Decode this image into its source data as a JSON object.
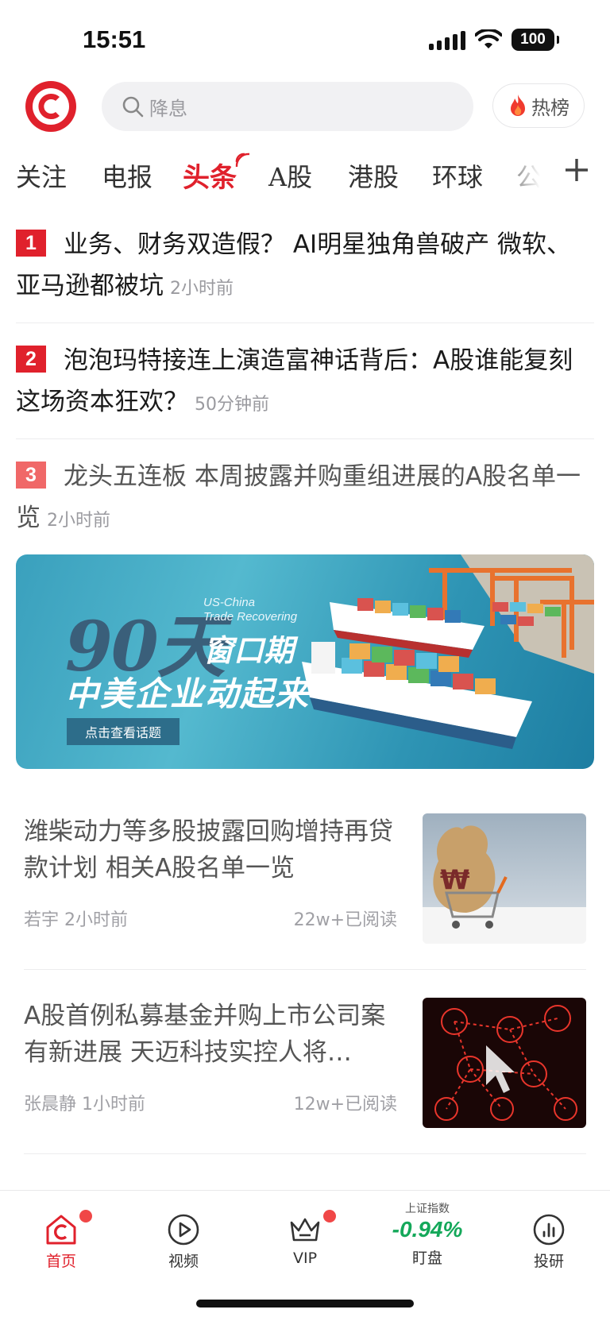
{
  "status": {
    "time": "15:51",
    "battery": "100"
  },
  "header": {
    "search_placeholder": "降息",
    "hot_label": "热榜",
    "logo_letter": "C"
  },
  "tabs": [
    {
      "label": "关注"
    },
    {
      "label": "电报"
    },
    {
      "label": "头条",
      "active": true
    },
    {
      "label": "A股"
    },
    {
      "label": "港股"
    },
    {
      "label": "环球"
    },
    {
      "label": "公"
    }
  ],
  "top_news": [
    {
      "rank": "1",
      "title": "业务、财务双造假？ AI明星独角兽破产 微软、亚马逊都被坑",
      "ago": "2小时前"
    },
    {
      "rank": "2",
      "title": "泡泡玛特接连上演造富神话背后：A股谁能复刻这场资本狂欢？",
      "ago": "50分钟前"
    },
    {
      "rank": "3",
      "title": "龙头五连板 本周披露并购重组进展的A股名单一览",
      "ago": "2小时前"
    }
  ],
  "banner": {
    "big_text": "90天",
    "en_line1": "US-China",
    "en_line2": "Trade Recovering",
    "window_text": "窗口期",
    "subtitle": "中美企业动起来",
    "button": "点击查看话题"
  },
  "articles": [
    {
      "title": "潍柴动力等多股披露回购增持再贷款计划 相关A股名单一览",
      "author": "若宇",
      "ago": "2小时前",
      "reads": "22w+已阅读",
      "thumb": "money-bag-cart"
    },
    {
      "title": "A股首例私募基金并购上市公司案有新进展 天迈科技实控人将…",
      "author": "张晨静",
      "ago": "1小时前",
      "reads": "12w+已阅读",
      "thumb": "network-people"
    }
  ],
  "tabbar": {
    "items": [
      {
        "label": "首页",
        "active": true,
        "badge": true
      },
      {
        "label": "视频"
      },
      {
        "label": "VIP",
        "badge": true
      },
      {
        "label": "盯盘",
        "index_name": "上证指数",
        "index_value": "-0.94%"
      },
      {
        "label": "投研"
      }
    ]
  },
  "colors": {
    "brand": "#e0212c",
    "down": "#14a85a"
  }
}
